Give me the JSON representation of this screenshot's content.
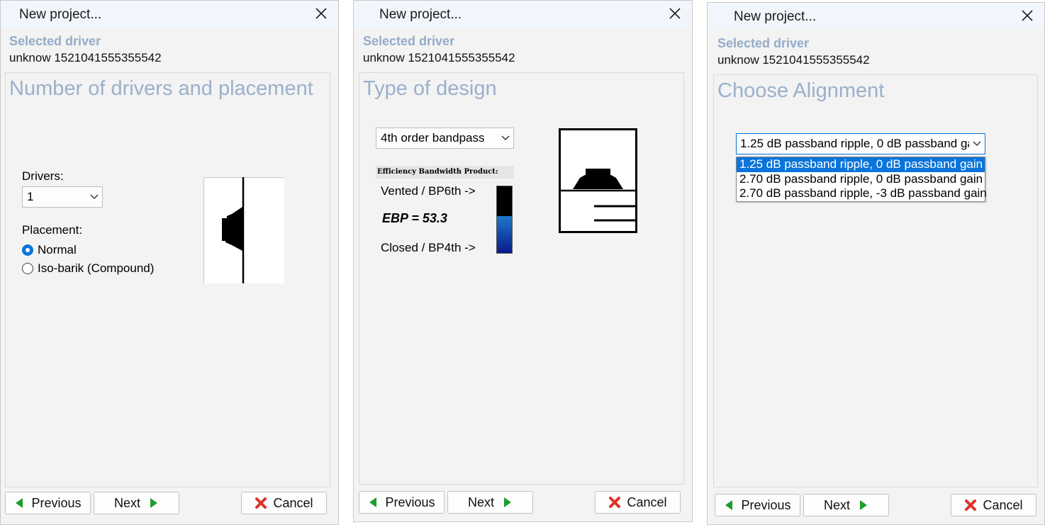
{
  "colors": {
    "accent": "#0a74da",
    "title_blue": "#9ab0cc",
    "next_green": "#1e9e2b",
    "cancel_red": "#e0322b"
  },
  "dialogs": [
    {
      "title": "New project...",
      "selected_driver_label": "Selected driver",
      "selected_driver_value": "unknow 1521041555355542",
      "panel_title": "Number of drivers and placement",
      "drivers_label": "Drivers:",
      "drivers_value": "1",
      "placement_label": "Placement:",
      "placement_options": [
        {
          "label": "Normal",
          "selected": true
        },
        {
          "label": "Iso-barik (Compound)",
          "selected": false
        }
      ],
      "buttons": {
        "previous": "Previous",
        "next": "Next",
        "cancel": "Cancel"
      }
    },
    {
      "title": "New project...",
      "selected_driver_label": "Selected driver",
      "selected_driver_value": "unknow 1521041555355542",
      "panel_title": "Type of design",
      "design_value": "4th order bandpass",
      "ebp_header": "Efficiency Bandwidth Product:",
      "vented_label": "Vented / BP6th ->",
      "ebp_value": "EBP = 53.3",
      "closed_label": "Closed / BP4th ->",
      "ebp_gauge_level": 0.55,
      "buttons": {
        "previous": "Previous",
        "next": "Next",
        "cancel": "Cancel"
      }
    },
    {
      "title": "New project...",
      "selected_driver_label": "Selected driver",
      "selected_driver_value": "unknow 1521041555355542",
      "panel_title": "Choose Alignment",
      "alignment_value": "1.25 dB passband ripple, 0 dB passband gain",
      "alignment_options": [
        "1.25 dB passband ripple, 0 dB passband gain",
        "2.70 dB passband ripple, 0 dB passband gain",
        "2.70 dB passband ripple, -3 dB passband gain"
      ],
      "buttons": {
        "previous": "Previous",
        "next": "Next",
        "cancel": "Cancel"
      }
    }
  ]
}
